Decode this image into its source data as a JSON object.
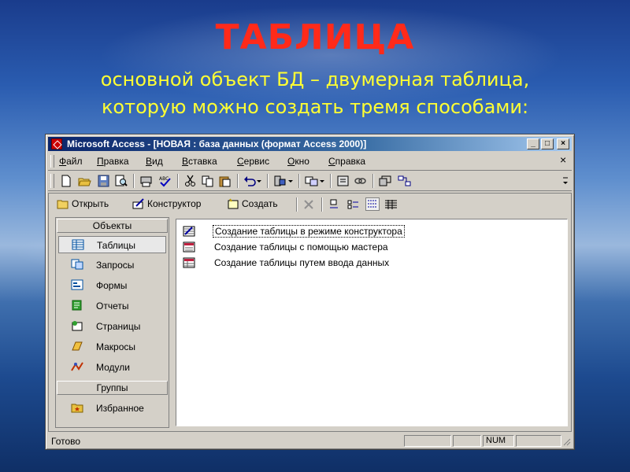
{
  "slide": {
    "title": "ТАБЛИЦА",
    "subtitle_line1": "основной объект БД – двумерная таблица,",
    "subtitle_line2": "которую можно создать тремя способами:"
  },
  "window": {
    "title": "Microsoft Access - [НОВАЯ : база данных (формат Access 2000)]",
    "controls": {
      "minimize": "_",
      "maximize": "□",
      "close": "×"
    }
  },
  "menubar": {
    "items": [
      {
        "label": "Файл",
        "underline": "Ф",
        "rest": "айл"
      },
      {
        "label": "Правка",
        "underline": "П",
        "rest": "равка"
      },
      {
        "label": "Вид",
        "underline": "В",
        "rest": "ид"
      },
      {
        "label": "Вставка",
        "underline": "В",
        "rest": "ставка"
      },
      {
        "label": "Сервис",
        "underline": "С",
        "rest": "ервис"
      },
      {
        "label": "Окно",
        "underline": "О",
        "rest": "кно"
      },
      {
        "label": "Справка",
        "underline": "С",
        "rest": "правка"
      }
    ],
    "close_doc": "×"
  },
  "toolbar": {
    "icons": [
      "new-icon",
      "open-icon",
      "save-icon",
      "search-icon",
      "print-preview-icon",
      "spelling-icon",
      "cut-icon",
      "copy-icon",
      "paste-icon",
      "undo-icon",
      "office-links-icon",
      "analyze-icon",
      "code-icon",
      "properties-icon",
      "relationships-icon",
      "new-object-icon"
    ]
  },
  "db_toolbar": {
    "open_label": "Открыть",
    "design_label": "Конструктор",
    "create_label": "Создать"
  },
  "sidebar": {
    "objects_header": "Объекты",
    "items": [
      {
        "label": "Таблицы",
        "icon": "table-icon",
        "selected": true
      },
      {
        "label": "Запросы",
        "icon": "query-icon"
      },
      {
        "label": "Формы",
        "icon": "form-icon"
      },
      {
        "label": "Отчеты",
        "icon": "report-icon"
      },
      {
        "label": "Страницы",
        "icon": "page-icon"
      },
      {
        "label": "Макросы",
        "icon": "macro-icon"
      },
      {
        "label": "Модули",
        "icon": "module-icon"
      }
    ],
    "groups_header": "Группы",
    "groups": [
      {
        "label": "Избранное",
        "icon": "favorites-folder-icon"
      }
    ]
  },
  "list": {
    "items": [
      {
        "label": "Создание таблицы в режиме конструктора"
      },
      {
        "label": "Создание таблицы с помощью мастера"
      },
      {
        "label": "Создание таблицы путем ввода данных"
      }
    ]
  },
  "statusbar": {
    "status": "Готово",
    "num": "NUM"
  },
  "colors": {
    "title_red": "#ff2a1a",
    "subtitle_yellow": "#ffff33",
    "titlebar_dark": "#0a246a",
    "window_face": "#d4d0c8"
  }
}
